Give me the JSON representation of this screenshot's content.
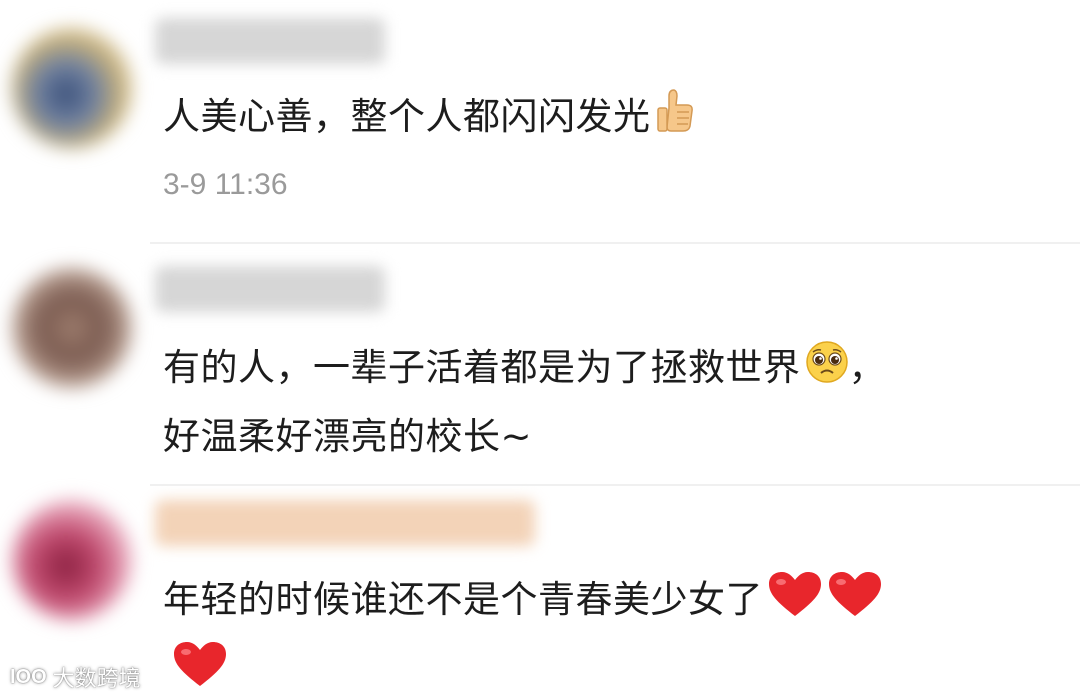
{
  "comments": [
    {
      "text": "人美心善，整个人都闪闪发光",
      "emoji": "thumbs-up",
      "timestamp": "3-9 11:36"
    },
    {
      "line1": "有的人，一辈子活着都是为了拯救世界",
      "line1_suffix": "，",
      "line2": "好温柔好漂亮的校长~",
      "emoji": "pleading-face"
    },
    {
      "text": "年轻的时候谁还不是个青春美少女了",
      "emoji": "red-heart"
    }
  ],
  "watermark": {
    "logo": "IOO",
    "text": "大数跨境"
  },
  "colors": {
    "text": "#1d1d1d",
    "timestamp": "#9a9a9a",
    "heart": "#e8262c",
    "divider": "#f0f0f0"
  }
}
